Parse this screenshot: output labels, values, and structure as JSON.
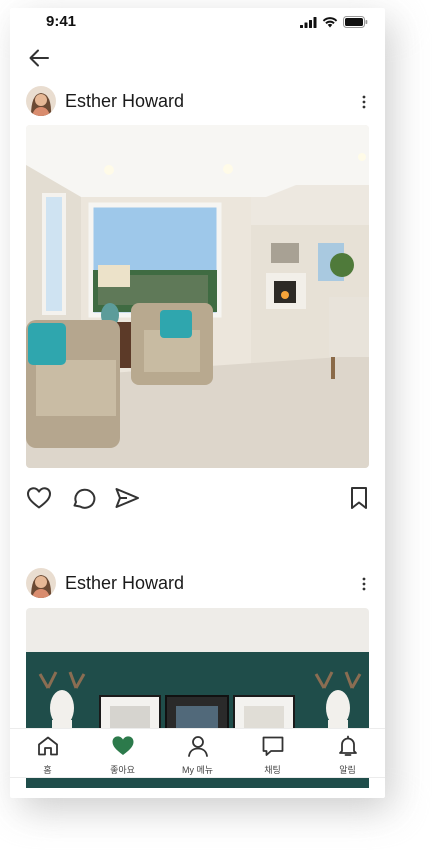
{
  "status_bar": {
    "time": "9:41"
  },
  "posts": [
    {
      "author": "Esther Howard",
      "image": "living-room-photo"
    },
    {
      "author": "Esther Howard",
      "image": "teal-wall-room-photo"
    }
  ],
  "tab_bar": {
    "tabs": [
      {
        "label": "홈",
        "icon": "home-icon"
      },
      {
        "label": "좋아요",
        "icon": "heart-icon",
        "active": true
      },
      {
        "label": "My 메뉴",
        "icon": "person-icon"
      },
      {
        "label": "채팅",
        "icon": "chat-icon"
      },
      {
        "label": "알림",
        "icon": "bell-icon"
      }
    ]
  },
  "colors": {
    "accent": "#2c7a4b",
    "text": "#1a1a1a",
    "icon": "#333333"
  }
}
